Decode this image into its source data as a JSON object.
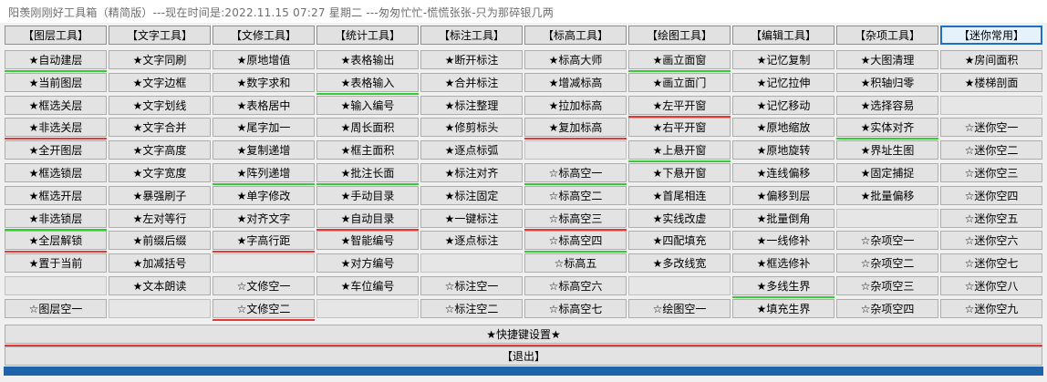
{
  "window": {
    "title": "阳羡刚刚好工具箱（精简版）---现在时间是:2022.11.15 07:27 星期二 ---匆匆忙忙-慌慌张张-只为那碎银几两"
  },
  "tabs": [
    {
      "label": "【图层工具】"
    },
    {
      "label": "【文字工具】"
    },
    {
      "label": "【文修工具】"
    },
    {
      "label": "【统计工具】"
    },
    {
      "label": "【标注工具】"
    },
    {
      "label": "【标高工具】"
    },
    {
      "label": "【绘图工具】"
    },
    {
      "label": "【编辑工具】"
    },
    {
      "label": "【杂项工具】"
    },
    {
      "label": "【迷你常用】",
      "selected": true
    }
  ],
  "columns": [
    {
      "items": [
        "★自动建层",
        "★当前图层",
        "★框选关层",
        "★非选关层",
        "★全开图层",
        "★框选锁层",
        "★框选开层",
        "★非选锁层",
        "★全层解锁",
        "★置于当前",
        "",
        "☆图层空一"
      ],
      "lines": [
        "green",
        "",
        "",
        "red",
        "",
        "",
        "",
        "green",
        "red",
        "",
        "",
        ""
      ]
    },
    {
      "items": [
        "★文字同刷",
        "★文字边框",
        "★文字划线",
        "★文字合并",
        "★文字高度",
        "★文字宽度",
        "★暴强刷子",
        "★左对等行",
        "★前缀后缀",
        "★加减括号",
        "★文本朗读",
        ""
      ],
      "lines": [
        "",
        "",
        "",
        "",
        "",
        "",
        "",
        "",
        "",
        "",
        "",
        ""
      ]
    },
    {
      "items": [
        "★原地增值",
        "★数字求和",
        "★表格居中",
        "★尾字加一",
        "★复制递增",
        "★阵列递增",
        "★单字修改",
        "★对齐文字",
        "★字高行距",
        "",
        "☆文修空一",
        "☆文修空二"
      ],
      "lines": [
        "",
        "",
        "",
        "",
        "",
        "green",
        "",
        "",
        "red",
        "",
        "",
        "red"
      ]
    },
    {
      "items": [
        "★表格输出",
        "★表格输入",
        "★输入编号",
        "★周长面积",
        "★框主面积",
        "★批注长面",
        "★手动目录",
        "★自动目录",
        "★智能编号",
        "★对方编号",
        "★车位编号",
        ""
      ],
      "lines": [
        "",
        "green",
        "",
        "",
        "",
        "green",
        "",
        "red",
        "",
        "",
        "",
        ""
      ]
    },
    {
      "items": [
        "★断开标注",
        "★合并标注",
        "★标注整理",
        "★修剪标头",
        "★逐点标弧",
        "★标注对齐",
        "★标注固定",
        "★一键标注",
        "★逐点标注",
        "",
        "☆标注空一",
        "☆标注空二"
      ],
      "lines": [
        "",
        "",
        "",
        "",
        "",
        "",
        "",
        "",
        "",
        "",
        "",
        ""
      ]
    },
    {
      "items": [
        "★标高大师",
        "★增减标高",
        "★拉加标高",
        "★复加标高",
        "",
        "☆标高空一",
        "☆标高空二",
        "☆标高空三",
        "☆标高空四",
        "☆标高五",
        "☆标高空六",
        "☆标高空七"
      ],
      "lines": [
        "",
        "",
        "",
        "red",
        "",
        "green",
        "",
        "red",
        "green",
        "",
        "",
        ""
      ]
    },
    {
      "items": [
        "★画立面窗",
        "★画立面门",
        "★左平开窗",
        "★右平开窗",
        "★上悬开窗",
        "★下悬开窗",
        "★首尾相连",
        "★实线改虚",
        "★四配填充",
        "★多改线宽",
        "",
        "☆绘图空一"
      ],
      "lines": [
        "green",
        "",
        "red",
        "",
        "green",
        "",
        "",
        "",
        "",
        "",
        "",
        ""
      ]
    },
    {
      "items": [
        "★记忆复制",
        "★记忆拉伸",
        "★记忆移动",
        "★原地缩放",
        "★原地旋转",
        "★连线偏移",
        "★偏移到层",
        "★批量倒角",
        "★一线修补",
        "★框选修补",
        "★多线生界",
        "★填充生界"
      ],
      "lines": [
        "",
        "",
        "",
        "",
        "",
        "",
        "",
        "",
        "",
        "",
        "green",
        ""
      ]
    },
    {
      "items": [
        "★大图清理",
        "★积轴归零",
        "★选择容易",
        "★实体对齐",
        "★界址生图",
        "★固定捕捉",
        "★批量偏移",
        "",
        "☆杂项空一",
        "☆杂项空二",
        "☆杂项空三",
        "☆杂项空四"
      ],
      "lines": [
        "",
        "",
        "",
        "green",
        "",
        "",
        "",
        "",
        "",
        "",
        "",
        ""
      ]
    },
    {
      "items": [
        "★房间面积",
        "★楼梯剖面",
        "",
        "☆迷你空一",
        "☆迷你空二",
        "☆迷你空三",
        "☆迷你空四",
        "☆迷你空五",
        "☆迷你空六",
        "☆迷你空七",
        "☆迷你空八",
        "☆迷你空九"
      ],
      "lines": [
        "",
        "",
        "",
        "",
        "",
        "",
        "",
        "",
        "",
        "",
        "",
        ""
      ]
    }
  ],
  "shortcut_button": "★快捷键设置★",
  "exit_button": "【退出】",
  "colors": {
    "accent_blue": "#1f64a8",
    "underline_green": "#33cc33",
    "underline_red": "#e03a3a"
  }
}
